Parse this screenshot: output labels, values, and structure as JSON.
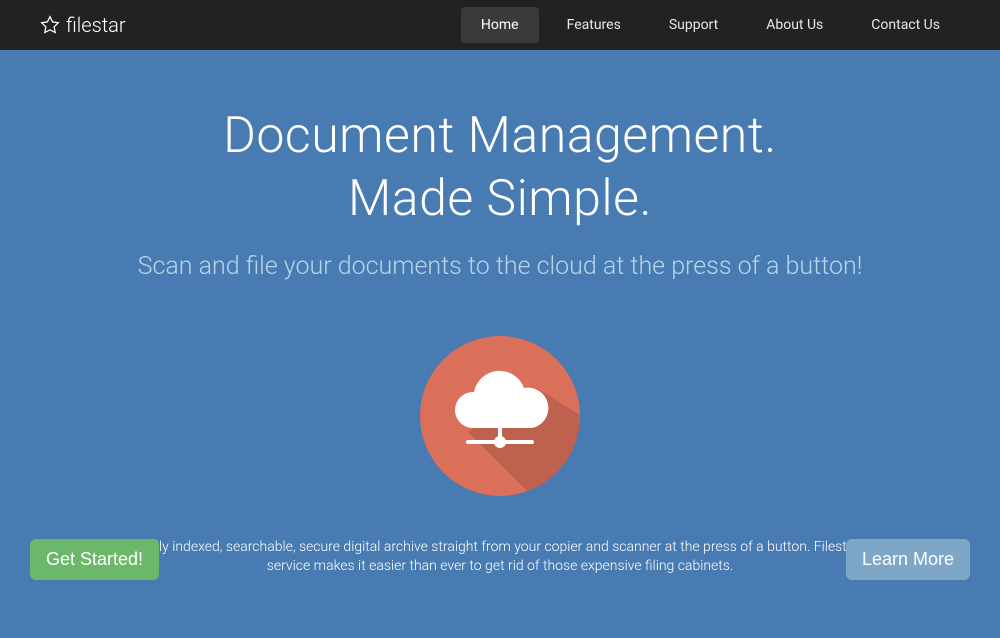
{
  "brand": {
    "name": "filestar"
  },
  "nav": {
    "items": [
      {
        "label": "Home",
        "active": true
      },
      {
        "label": "Features",
        "active": false
      },
      {
        "label": "Support",
        "active": false
      },
      {
        "label": "About Us",
        "active": false
      },
      {
        "label": "Contact Us",
        "active": false
      }
    ]
  },
  "hero": {
    "title_line1": "Document Management.",
    "title_line2": "Made Simple.",
    "subtitle": "Scan and file your documents to the cloud at the press of a button!",
    "description": "From paper to fully indexed, searchable, secure digital archive straight from your copier and scanner at the press of a button. Filestar's cloud-based service makes it easier than ever to get rid of those expensive filing cabinets.",
    "cta_primary": "Get Started!",
    "cta_secondary": "Learn More"
  },
  "colors": {
    "navbar_bg": "#222222",
    "hero_bg": "#477bb2",
    "btn_primary": "#6bb86b",
    "btn_secondary": "#7ea6c6",
    "badge_bg": "#da6f5a"
  }
}
